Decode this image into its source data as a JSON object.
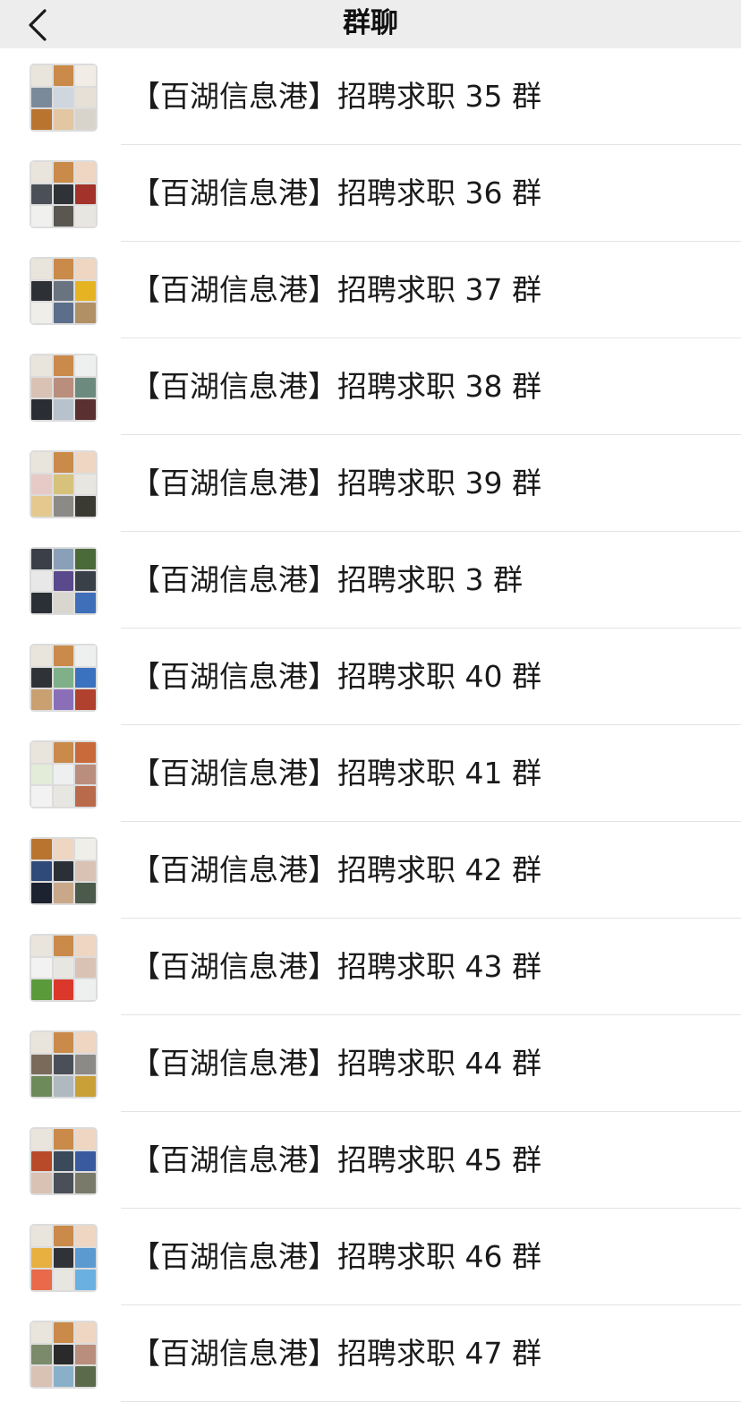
{
  "nav": {
    "title": "群聊",
    "back_icon": "chevron-left-icon"
  },
  "groups": [
    {
      "name": "【百湖信息港】招聘求职 35 群",
      "avatar_colors": [
        "#e9e4dc",
        "#c98a4a",
        "#f1ede6",
        "#7b8a9b",
        "#cfd6dd",
        "#e6e0d6",
        "#b9742f",
        "#e3c7a3",
        "#d8d4cc"
      ]
    },
    {
      "name": "【百湖信息港】招聘求职 36 群",
      "avatar_colors": [
        "#e9e4dc",
        "#c98a4a",
        "#eed6c2",
        "#4b4f57",
        "#2f3338",
        "#a3322a",
        "#f0f0ee",
        "#5a5650",
        "#e8e6e1"
      ]
    },
    {
      "name": "【百湖信息港】招聘求职 37 群",
      "avatar_colors": [
        "#e9e4dc",
        "#c98a4a",
        "#eed6c2",
        "#2d3035",
        "#6a7480",
        "#e6b322",
        "#f0eee9",
        "#5b6f8c",
        "#b09064"
      ]
    },
    {
      "name": "【百湖信息港】招聘求职 38 群",
      "avatar_colors": [
        "#e9e4dc",
        "#c98a4a",
        "#eef0f0",
        "#d9c2b4",
        "#b98e7c",
        "#6d8a7e",
        "#2a2d33",
        "#b8c2cc",
        "#5a3030"
      ]
    },
    {
      "name": "【百湖信息港】招聘求职 39 群",
      "avatar_colors": [
        "#e9e4dc",
        "#c98a4a",
        "#eed6c2",
        "#e7c9c5",
        "#d6c27a",
        "#e8e6e1",
        "#e4c88e",
        "#8c8a86",
        "#3a3a32"
      ]
    },
    {
      "name": "【百湖信息港】招聘求职 3 群",
      "avatar_colors": [
        "#3a3f48",
        "#8aa0b8",
        "#4b6a3a",
        "#e8e8e8",
        "#5a4a8c",
        "#3a4048",
        "#2b2f36",
        "#d9d6d0",
        "#3f6fb8"
      ]
    },
    {
      "name": "【百湖信息港】招聘求职 40 群",
      "avatar_colors": [
        "#e9e4dc",
        "#c98a4a",
        "#eef0f0",
        "#2f3338",
        "#7fb08a",
        "#3a72c0",
        "#c9a070",
        "#8a6fb8",
        "#b0412e"
      ]
    },
    {
      "name": "【百湖信息港】招聘求职 41 群",
      "avatar_colors": [
        "#e9e4dc",
        "#c98a4a",
        "#c96a3a",
        "#e2ecd8",
        "#eef0f0",
        "#b98e7c",
        "#f2f2f2",
        "#e8e6e1",
        "#b96a4a"
      ]
    },
    {
      "name": "【百湖信息港】招聘求职 42 群",
      "avatar_colors": [
        "#b9742f",
        "#eed6c2",
        "#f0eee9",
        "#2f4a78",
        "#2b2f36",
        "#d9c2b4",
        "#1d2230",
        "#c9a88a",
        "#4b5a4a"
      ]
    },
    {
      "name": "【百湖信息港】招聘求职 43 群",
      "avatar_colors": [
        "#e9e4dc",
        "#c98a4a",
        "#eed6c2",
        "#f2f2f2",
        "#e8e6e1",
        "#d9c2b4",
        "#5a9a3a",
        "#d9382a",
        "#eef0f0"
      ]
    },
    {
      "name": "【百湖信息港】招聘求职 44 群",
      "avatar_colors": [
        "#e9e4dc",
        "#c98a4a",
        "#eed6c2",
        "#7a6a5a",
        "#4b5058",
        "#8c8a86",
        "#6d8a5a",
        "#b0b8c0",
        "#c9a038"
      ]
    },
    {
      "name": "【百湖信息港】招聘求职 45 群",
      "avatar_colors": [
        "#e9e4dc",
        "#c98a4a",
        "#eed6c2",
        "#b84a2a",
        "#3a4a5a",
        "#3a5aa0",
        "#d9c2b4",
        "#4b4f57",
        "#7a7a6a"
      ]
    },
    {
      "name": "【百湖信息港】招聘求职 46 群",
      "avatar_colors": [
        "#e9e4dc",
        "#c98a4a",
        "#eed6c2",
        "#e8b040",
        "#2f3338",
        "#5a9ad0",
        "#e86a4a",
        "#e8e6e1",
        "#6ab0e0"
      ]
    },
    {
      "name": "【百湖信息港】招聘求职 47 群",
      "avatar_colors": [
        "#e9e4dc",
        "#c98a4a",
        "#eed6c2",
        "#7a8a6a",
        "#2a2a2a",
        "#b98e7c",
        "#d9c2b4",
        "#8ab0c9",
        "#5a6a4a"
      ]
    }
  ]
}
